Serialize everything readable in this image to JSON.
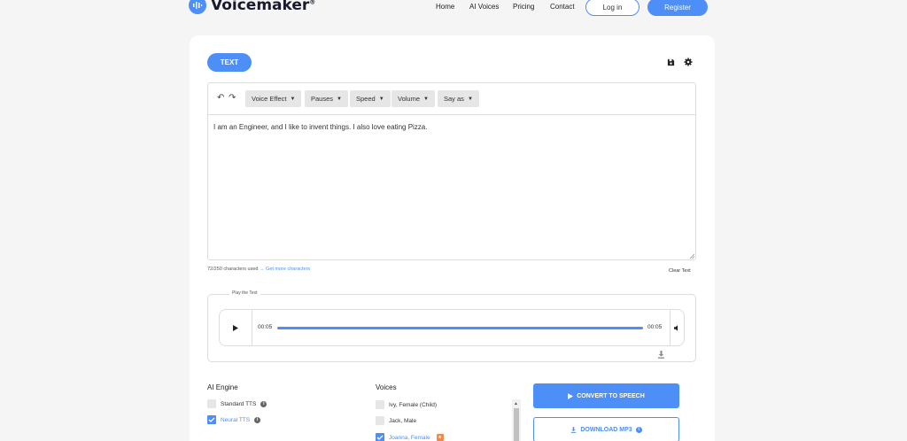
{
  "brand": {
    "name": "Voicemaker",
    "mark": "®"
  },
  "nav": {
    "items": [
      "Home",
      "AI Voices",
      "Pricing",
      "Contact"
    ],
    "login": "Log in",
    "register": "Register"
  },
  "editor": {
    "tab": "TEXT",
    "toolbar": [
      "Voice Effect",
      "Pauses",
      "Speed",
      "Volume",
      "Say as"
    ],
    "text": "I am an Engineer, and I like to invent things. I also love eating Pizza.",
    "chars_used": "72/250 characters used",
    "get_more": "→ Get more characters",
    "clear": "Clear Text"
  },
  "player": {
    "legend": "Play the Text",
    "current_time": "00:05",
    "duration": "00:05",
    "progress": 1.0
  },
  "engine": {
    "title": "AI Engine",
    "options": [
      {
        "label": "Standard TTS",
        "checked": false
      },
      {
        "label": "Neural TTS",
        "checked": true
      }
    ]
  },
  "voices": {
    "title": "Voices",
    "items": [
      {
        "label": "Ivy, Female (Child)",
        "checked": false
      },
      {
        "label": "Jack, Male",
        "checked": false
      },
      {
        "label": "Joanna, Female",
        "checked": true
      }
    ]
  },
  "actions": {
    "convert": "CONVERT TO SPEECH",
    "download": "DOWNLOAD MP3"
  },
  "colors": {
    "accent": "#4d8ef7",
    "badge": "#f08a4b"
  }
}
